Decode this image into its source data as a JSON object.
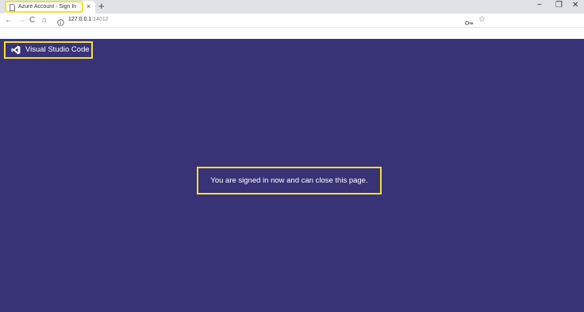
{
  "browser": {
    "tab": {
      "title": "Azure Account - Sign In",
      "close_glyph": "×"
    },
    "new_tab_glyph": "+",
    "window_controls": {
      "minimize": "−",
      "restore": "❐",
      "close": "✕"
    },
    "nav": {
      "back": "←",
      "forward": "→",
      "reload": "C",
      "home": "⌂"
    },
    "address": {
      "host": "127.0.0.1",
      "port": ":14012"
    },
    "star_glyph": "☆",
    "highlight_color": "#f5e12a"
  },
  "page": {
    "background": "#383277",
    "brand": {
      "name": "Visual Studio Code",
      "logo_icon": "vscode-logo-icon"
    },
    "message": "You are signed in now and can close this page."
  }
}
